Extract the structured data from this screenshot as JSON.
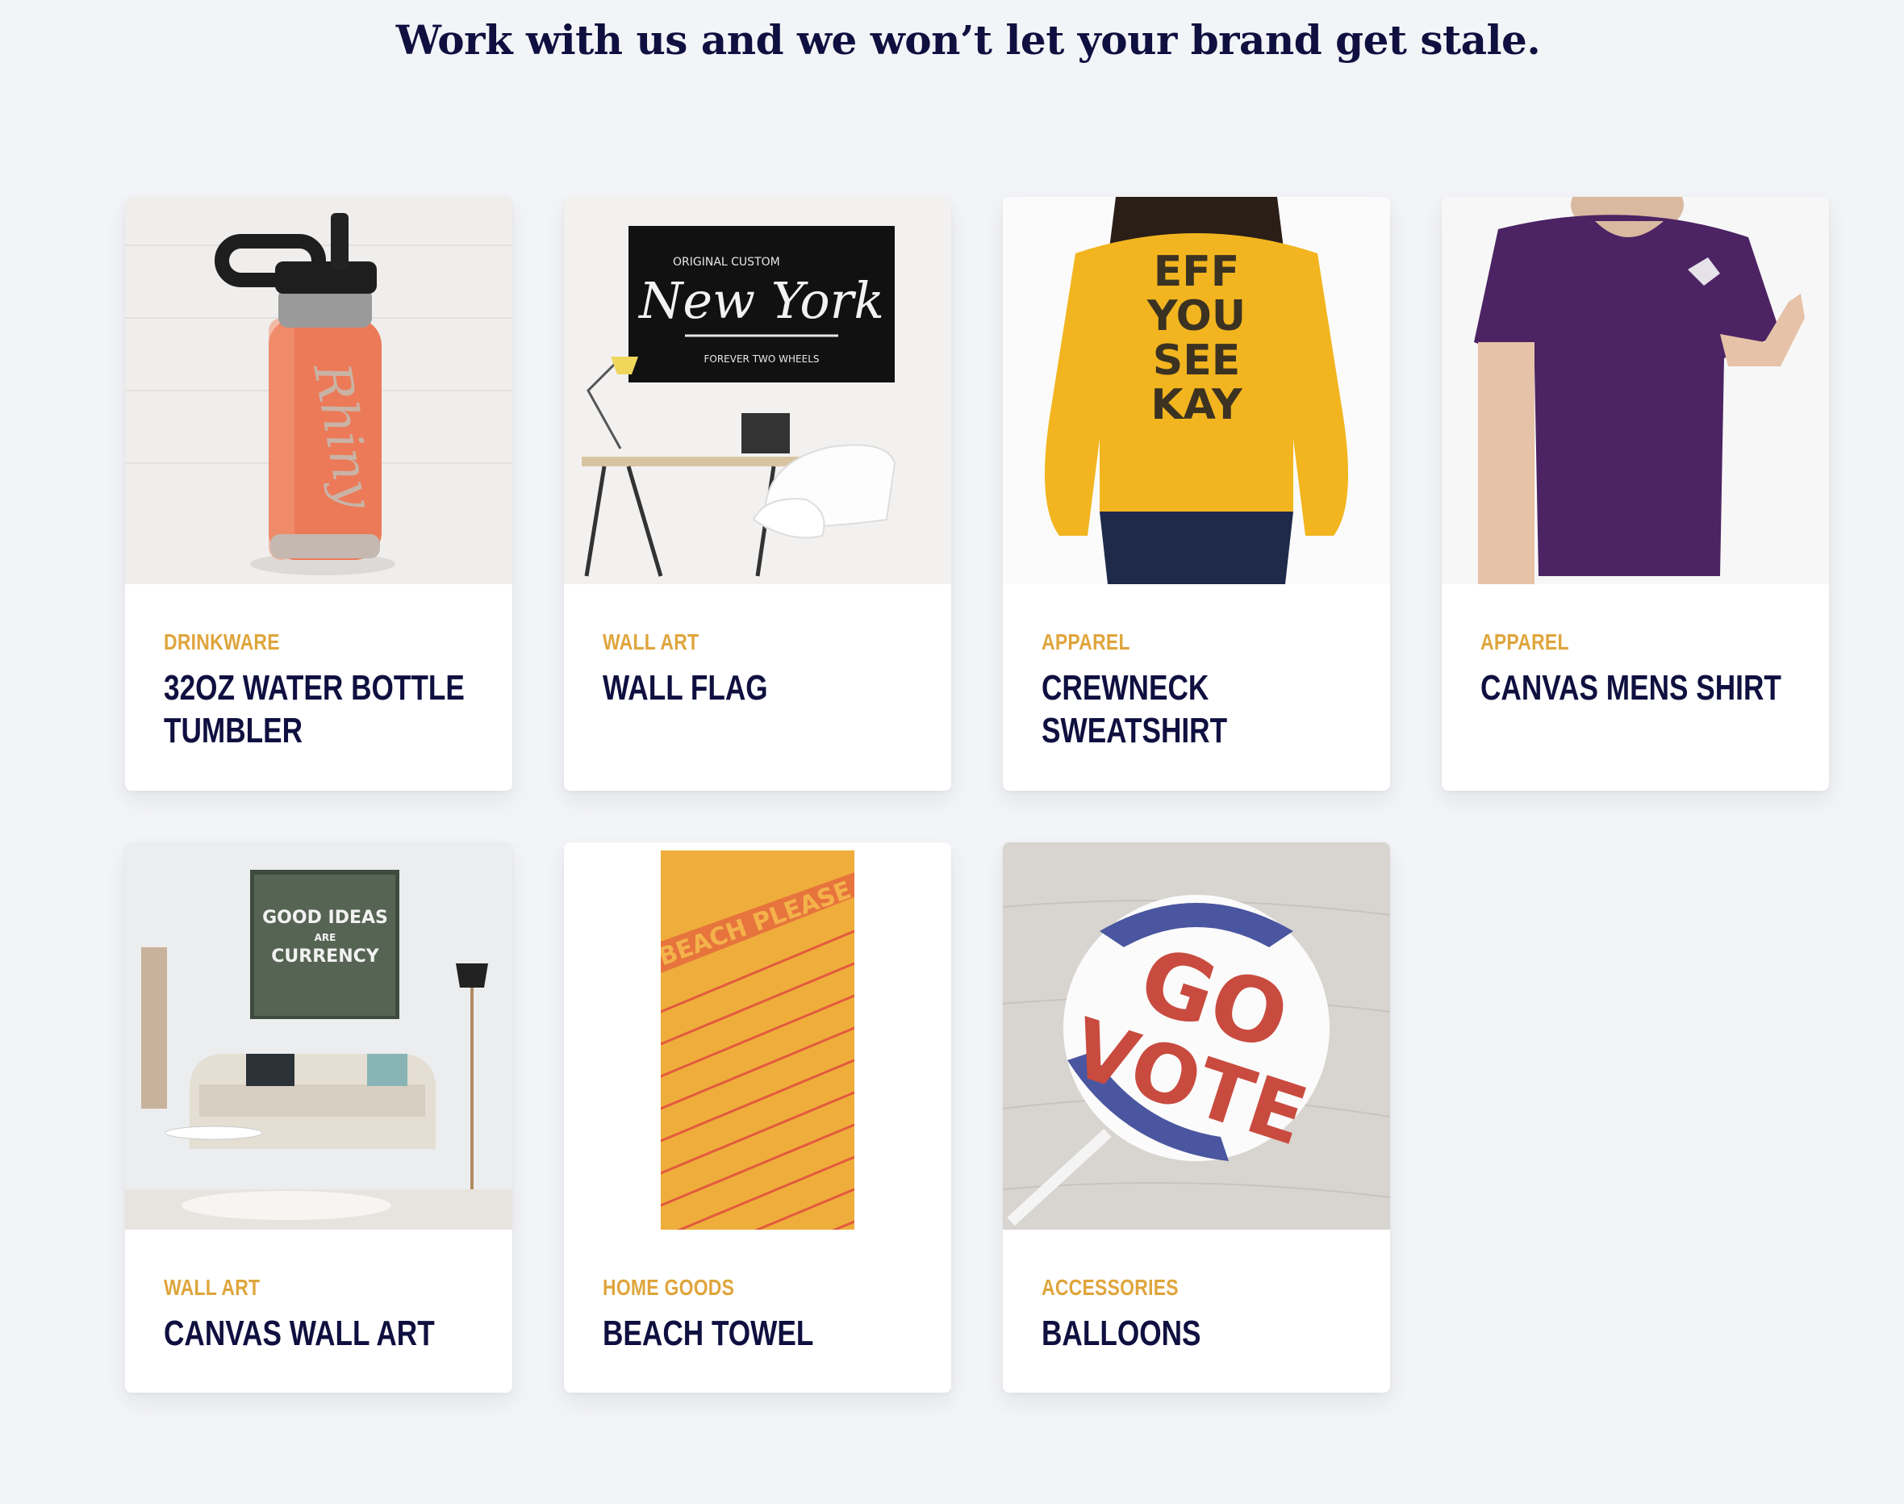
{
  "headline": "Work with us and we won’t let your brand get stale.",
  "products": [
    {
      "category": "Drinkware",
      "title": "32oz Water Bottle Tumbler",
      "image_icon": "water-bottle-photo",
      "bottle_engraving": "Rhiny"
    },
    {
      "category": "Wall Art",
      "title": "Wall Flag",
      "image_icon": "wall-flag-photo",
      "flag_text": {
        "top": "ORIGINAL CUSTOM",
        "main": "New York",
        "bottom": "FOREVER TWO WHEELS"
      }
    },
    {
      "category": "Apparel",
      "title": "Crewneck Sweatshirt",
      "image_icon": "sweatshirt-photo",
      "print_lines": [
        "EFF",
        "YOU",
        "SEE",
        "KAY"
      ]
    },
    {
      "category": "Apparel",
      "title": "Canvas Mens Shirt",
      "image_icon": "tshirt-photo"
    },
    {
      "category": "Wall Art",
      "title": "Canvas Wall Art",
      "image_icon": "canvas-art-photo",
      "art_text": [
        "GOOD IDEAS",
        "ARE",
        "CURRENCY"
      ]
    },
    {
      "category": "Home Goods",
      "title": "Beach Towel",
      "image_icon": "beach-towel-photo",
      "towel_text": "BEACH PLEASE"
    },
    {
      "category": "Accessories",
      "title": "Balloons",
      "image_icon": "balloon-photo",
      "balloon_text": [
        "GO",
        "VOTE"
      ]
    }
  ],
  "colors": {
    "navy": "#0f1040",
    "gold": "#dfa53c",
    "background": "#f3f4f7"
  }
}
